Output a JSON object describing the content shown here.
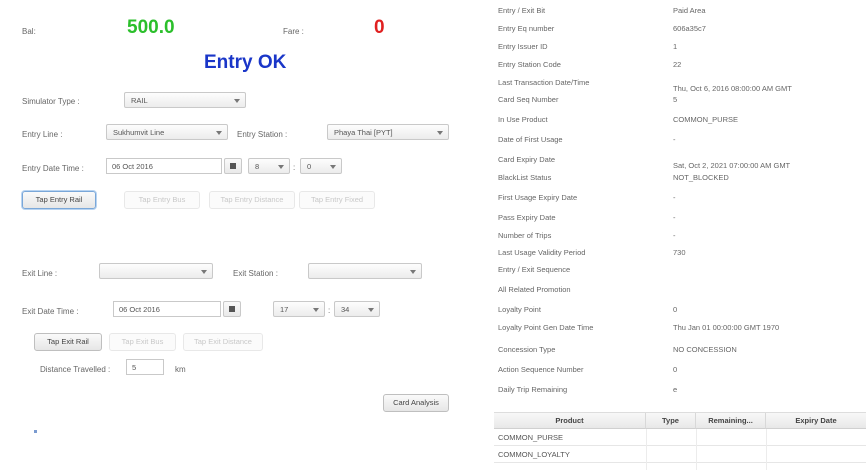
{
  "top": {
    "bal_label": "Bal:",
    "balance": "500.0",
    "fare_label": "Fare :",
    "fare": "0",
    "status": "Entry OK",
    "colors": {
      "balance": "#2bbf2b",
      "fare": "#e02020",
      "status": "#1a36c8"
    }
  },
  "sim": {
    "label": "Simulator Type :",
    "value": "RAIL"
  },
  "entry": {
    "line_label": "Entry Line :",
    "line_value": "Sukhumvit Line",
    "station_label": "Entry Station :",
    "station_value": "Phaya Thai [PYT]",
    "date_label": "Entry Date Time :",
    "date_value": "06 Oct 2016",
    "hour": "8",
    "sep": ":",
    "minute": "0",
    "buttons": [
      "Tap Entry Rail",
      "Tap Entry Bus",
      "Tap Entry Distance",
      "Tap Entry Fixed"
    ]
  },
  "exit": {
    "line_label": "Exit Line :",
    "line_value": "",
    "station_label": "Exit Station :",
    "station_value": "",
    "date_label": "Exit Date Time :",
    "date_value": "06 Oct 2016",
    "hour": "17",
    "sep": ":",
    "minute": "34",
    "buttons": [
      "Tap Exit Rail",
      "Tap Exit Bus",
      "Tap Exit Distance"
    ],
    "distance_label": "Distance Travelled :",
    "distance_value": "5",
    "distance_unit": "km"
  },
  "card_analysis": "Card Analysis",
  "details": [
    {
      "k": "Entry / Exit Bit",
      "v": "Paid Area"
    },
    {
      "k": "Entry Eq number",
      "v": "606a35c7"
    },
    {
      "k": "Entry Issuer ID",
      "v": "1"
    },
    {
      "k": "Entry Station Code",
      "v": "22"
    },
    {
      "k": "Last Transaction Date/Time",
      "v": "Thu, Oct 6, 2016 08:00:00 AM GMT"
    },
    {
      "k": "Card Seq Number",
      "v": "5"
    },
    {
      "k": "In Use Product",
      "v": "COMMON_PURSE"
    },
    {
      "k": "Date of First Usage",
      "v": "-"
    },
    {
      "k": "Card Expiry Date",
      "v": "Sat, Oct 2, 2021 07:00:00 AM GMT"
    },
    {
      "k": "BlackList Status",
      "v": "NOT_BLOCKED"
    },
    {
      "k": "First Usage Expiry Date",
      "v": "-"
    },
    {
      "k": "Pass Expiry Date",
      "v": "-"
    },
    {
      "k": "Number of Trips",
      "v": "-"
    },
    {
      "k": "Last Usage Validity Period",
      "v": "730"
    },
    {
      "k": "Entry / Exit Sequence",
      "v": ""
    },
    {
      "k": "All Related Promotion",
      "v": ""
    },
    {
      "k": "Loyalty Point",
      "v": "0"
    },
    {
      "k": "Loyalty Point Gen Date Time",
      "v": "Thu Jan 01 00:00:00 GMT 1970"
    },
    {
      "k": "Concession Type",
      "v": "NO CONCESSION"
    },
    {
      "k": "Action Sequence Number",
      "v": "0"
    },
    {
      "k": "Daily Trip Remaining",
      "v": "e"
    }
  ],
  "table": {
    "headers": [
      "Product",
      "Type",
      "Remaining...",
      "Expiry Date"
    ],
    "rows": [
      "COMMON_PURSE",
      "COMMON_LOYALTY"
    ]
  }
}
